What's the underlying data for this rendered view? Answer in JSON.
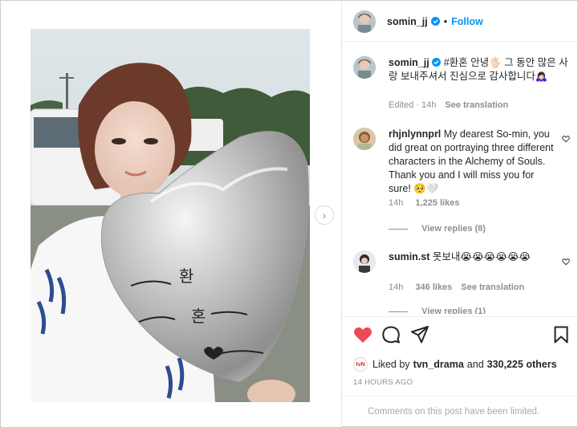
{
  "colors": {
    "accent": "#0095f6",
    "like_red": "#ed4956",
    "text": "#262626",
    "muted": "#8e8e8e"
  },
  "icons": [
    "verified-badge-icon",
    "chevron-right-icon",
    "heart-filled-icon",
    "comment-icon",
    "share-icon",
    "bookmark-icon",
    "small-heart-icon",
    "tvn-logo-icon"
  ],
  "post": {
    "media": {
      "next_glyph": "›"
    },
    "header": {
      "username": "somin_jj",
      "follow_label": "Follow"
    },
    "caption": {
      "username": "somin_jj",
      "text": "#환혼 안녕🖐🏻 그 동안 많은 사랑 보내주셔서 진심으로 감사합니다🙇🏻‍♀️",
      "meta": "Edited · 14h",
      "see_translation": "See translation"
    },
    "comments": [
      {
        "username": "rhjnlynnprl",
        "text": "My dearest So-min, you did great on portraying three different characters in the Alchemy of Souls. Thank you and I will miss you for sure! 🥺🤍",
        "time": "14h",
        "likes": "1,225 likes",
        "view_replies": "View replies (8)"
      },
      {
        "username": "sumin.st",
        "text": "못보내😭😭😭😭😭😭",
        "time": "14h",
        "likes": "346 likes",
        "see_translation": "See translation",
        "view_replies": "View replies (1)"
      }
    ],
    "liked_by": {
      "prefix": "Liked by",
      "user": "tvn_drama",
      "conj": "and",
      "others": "330,225 others",
      "logo_text": "tvN"
    },
    "timestamp": "14 HOURS AGO",
    "comments_limited": "Comments on this post have been limited."
  }
}
